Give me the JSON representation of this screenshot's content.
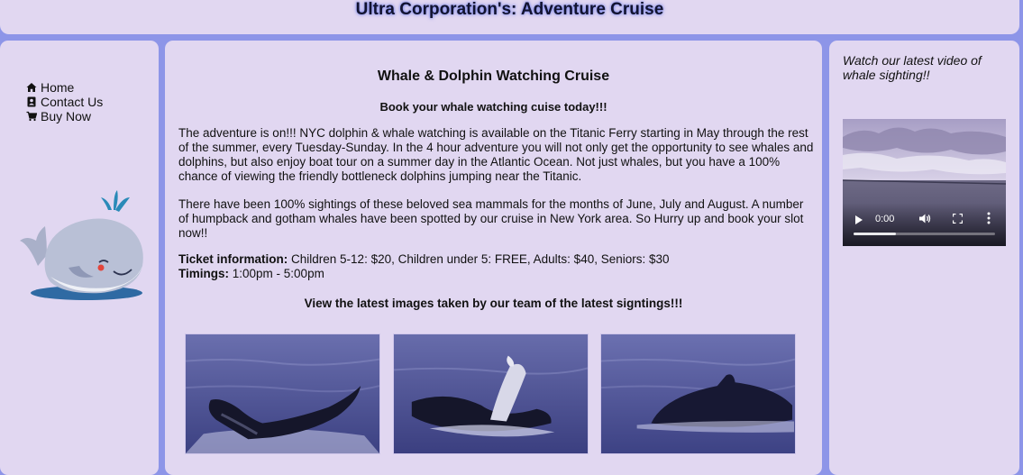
{
  "header": {
    "title": "Ultra Corporation's: Adventure Cruise"
  },
  "sidebar": {
    "nav": [
      {
        "label": "Home",
        "icon": "home-icon"
      },
      {
        "label": "Contact Us",
        "icon": "contact-icon"
      },
      {
        "label": "Buy Now",
        "icon": "cart-icon"
      }
    ]
  },
  "main": {
    "title": "Whale & Dolphin Watching Cruise",
    "subtitle": "Book your whale watching cuise today!!!",
    "paragraph1": "The adventure is on!!! NYC dolphin & whale watching is available on the Titanic Ferry starting in May through the rest of the summer, every Tuesday-Sunday. In the 4 hour adventure you will not only get the opportunity to see whales and dolphins, but also enjoy boat tour on a summer day in the Atlantic Ocean. Not just whales, but you have a 100% chance of viewing the friendly bottleneck dolphins jumping near the Titanic.",
    "paragraph2": "There have been 100% sightings of these beloved sea mammals for the months of June, July and August. A number of humpback and gotham whales have been spotted by our cruise in New York area. So Hurry up and book your slot now!!",
    "ticket_label": "Ticket information:",
    "ticket_text": " Children 5-12: $20, Children under 5: FREE, Adults: $40, Seniors: $30",
    "timings_label": "Timings:",
    "timings_text": " 1:00pm - 5:00pm",
    "latest": "View the latest images taken by our team of the latest signtings!!!"
  },
  "right": {
    "title": "Watch our latest video of whale sighting!!",
    "video": {
      "time": "0:00",
      "progress": 0.3
    }
  },
  "colors": {
    "background": "#8d95e8",
    "panel": "#e1d7f1"
  }
}
